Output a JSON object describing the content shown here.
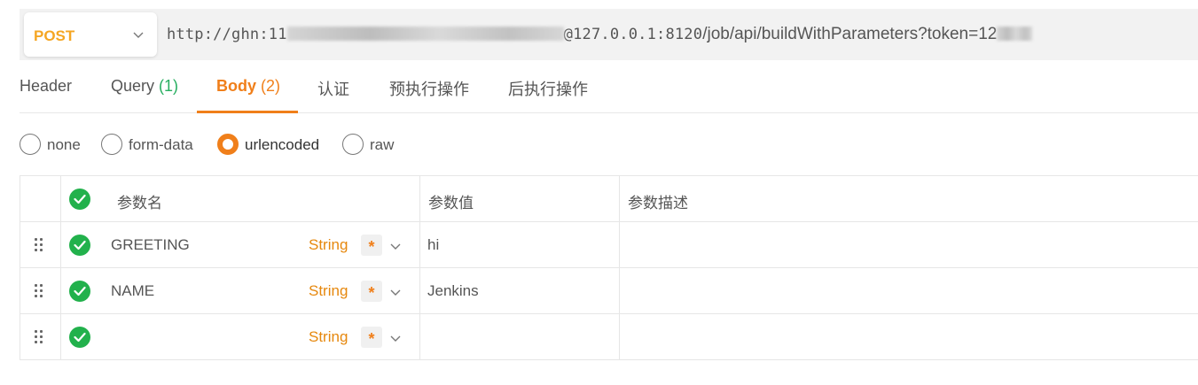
{
  "request": {
    "method": "POST",
    "url_prefix": "http://ghn:11",
    "url_suffix_mono": "@127.0.0.1:8120",
    "url_suffix": "/job/api/buildWithParameters?token=12"
  },
  "tabs": [
    {
      "label": "Header",
      "count": ""
    },
    {
      "label": "Query",
      "count": "(1)"
    },
    {
      "label": "Body",
      "count": "(2)"
    },
    {
      "label": "认证",
      "count": ""
    },
    {
      "label": "预执行操作",
      "count": ""
    },
    {
      "label": "后执行操作",
      "count": ""
    }
  ],
  "active_tab": "Body",
  "body_types": [
    {
      "label": "none",
      "selected": false
    },
    {
      "label": "form-data",
      "selected": false
    },
    {
      "label": "urlencoded",
      "selected": true
    },
    {
      "label": "raw",
      "selected": false
    }
  ],
  "params_table": {
    "headers": {
      "name": "参数名",
      "value": "参数值",
      "description": "参数描述"
    },
    "rows": [
      {
        "enabled": true,
        "name": "GREETING",
        "type": "String",
        "required": "*",
        "value": "hi",
        "description": ""
      },
      {
        "enabled": true,
        "name": "NAME",
        "type": "String",
        "required": "*",
        "value": "Jenkins",
        "description": ""
      },
      {
        "enabled": true,
        "name": "",
        "type": "String",
        "required": "*",
        "value": "",
        "description": ""
      }
    ]
  },
  "colors": {
    "accent": "#f07f1a",
    "method": "#f5a623",
    "enabled_check": "#22b14c",
    "count": "#27ae60"
  }
}
